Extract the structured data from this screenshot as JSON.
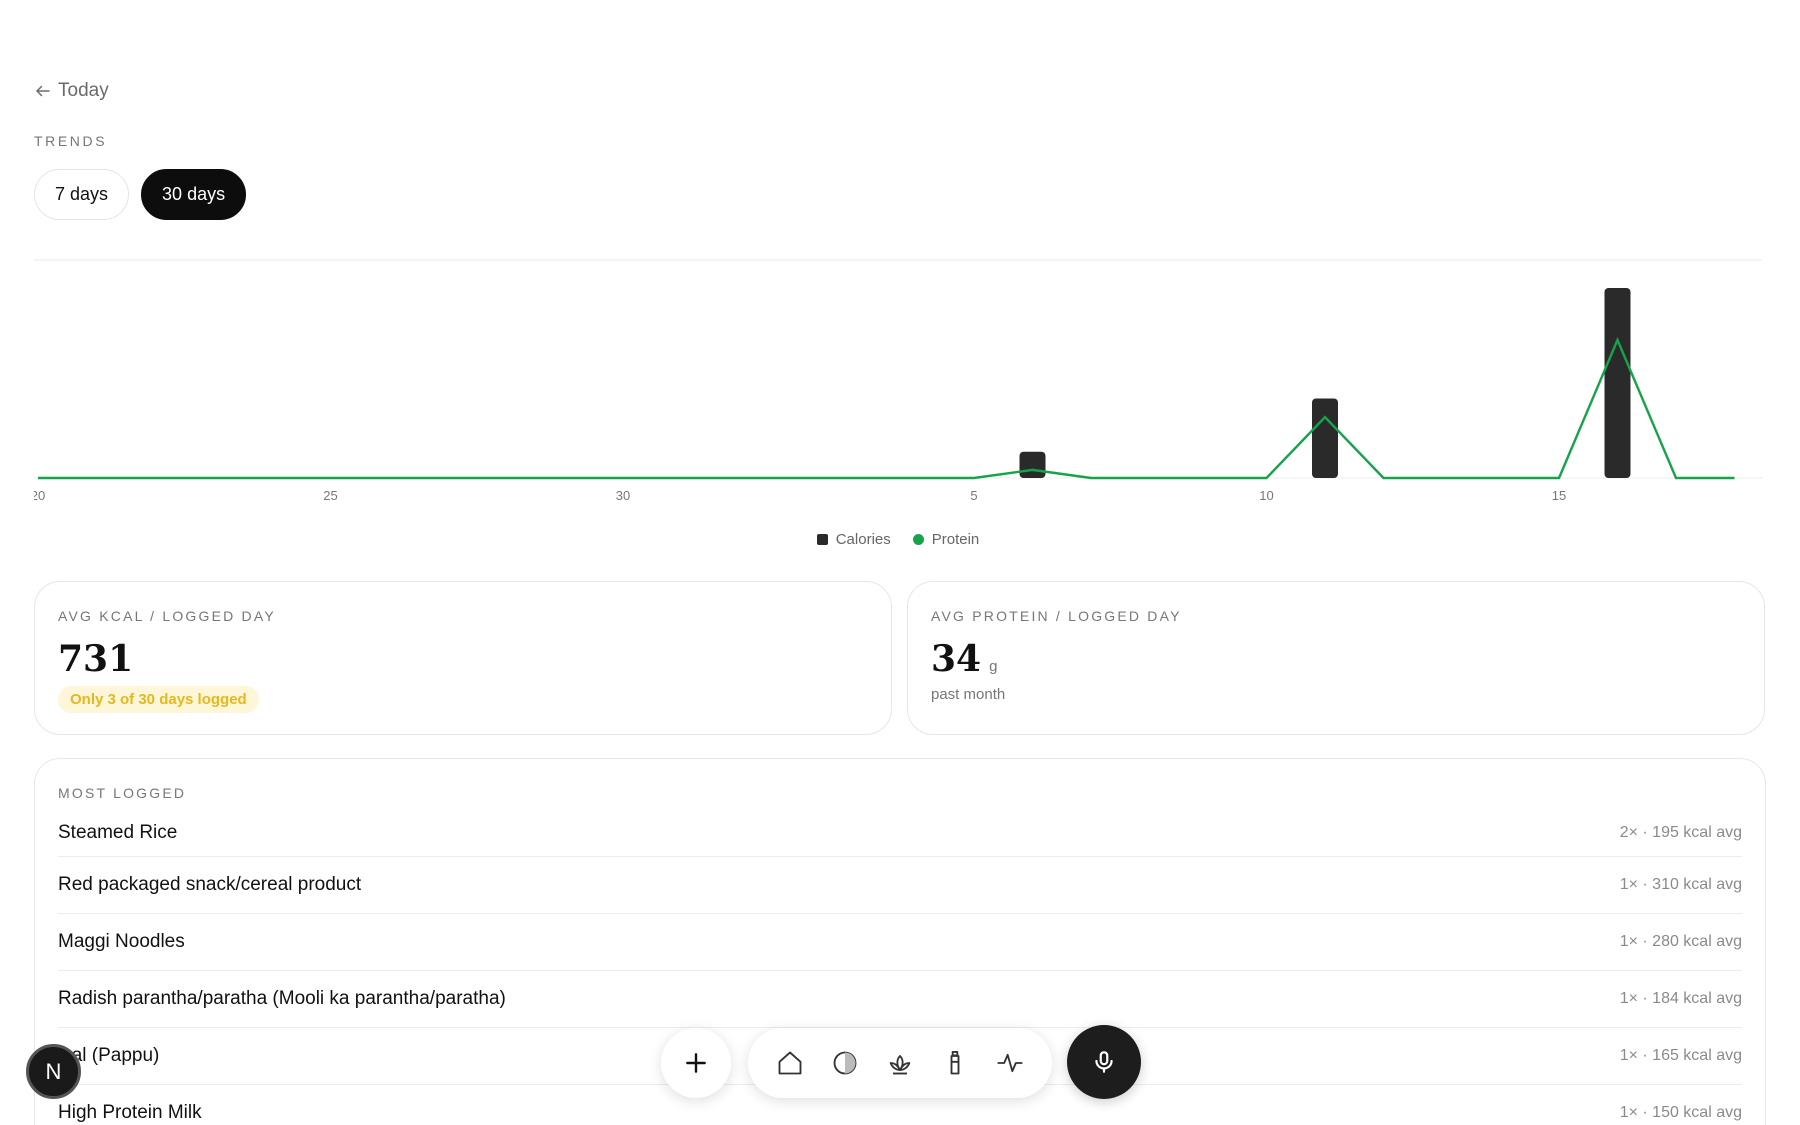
{
  "nav": {
    "back_label": "Today"
  },
  "trends": {
    "section_label": "TRENDS",
    "tabs": [
      {
        "label": "7 days",
        "active": false
      },
      {
        "label": "30 days",
        "active": true
      }
    ]
  },
  "chart_data": {
    "type": "bar",
    "x_tick_labels": [
      "20",
      "25",
      "30",
      "5",
      "10",
      "15"
    ],
    "days": [
      "20",
      "21",
      "22",
      "23",
      "24",
      "25",
      "26",
      "27",
      "28",
      "29",
      "30",
      "31",
      "1",
      "2",
      "3",
      "4",
      "5",
      "6",
      "7",
      "8",
      "9",
      "10",
      "11",
      "12",
      "13",
      "14",
      "15",
      "16",
      "17",
      "18"
    ],
    "series": [
      {
        "name": "Calories",
        "kind": "bar",
        "color": "#2a2a2a",
        "values": [
          0,
          0,
          0,
          0,
          0,
          0,
          0,
          0,
          0,
          0,
          0,
          0,
          0,
          0,
          0,
          0,
          0,
          195,
          0,
          0,
          0,
          0,
          590,
          0,
          0,
          0,
          0,
          1410,
          0,
          0
        ]
      },
      {
        "name": "Protein",
        "kind": "line",
        "color": "#16a34a",
        "values": [
          0,
          0,
          0,
          0,
          0,
          0,
          0,
          0,
          0,
          0,
          0,
          0,
          0,
          0,
          0,
          0,
          0,
          4,
          0,
          0,
          0,
          0,
          30,
          0,
          0,
          0,
          0,
          68,
          0,
          0
        ]
      }
    ],
    "legend": [
      "Calories",
      "Protein"
    ],
    "legend_position": "bottom-center",
    "grid": false
  },
  "stats": {
    "kcal": {
      "label": "AVG KCAL / LOGGED DAY",
      "value": "731",
      "badge": "Only 3 of 30 days logged"
    },
    "protein": {
      "label": "AVG PROTEIN / LOGGED DAY",
      "value": "34",
      "unit": "g",
      "sub": "past month"
    }
  },
  "most_logged": {
    "label": "MOST LOGGED",
    "items": [
      {
        "name": "Steamed Rice",
        "meta": "2× · 195 kcal avg"
      },
      {
        "name": "Red packaged snack/cereal product",
        "meta": "1× · 310 kcal avg"
      },
      {
        "name": "Maggi Noodles",
        "meta": "1× · 280 kcal avg"
      },
      {
        "name": "Radish parantha/paratha (Mooli ka parantha/paratha)",
        "meta": "1× · 184 kcal avg"
      },
      {
        "name": "Dal (Pappu)",
        "meta": "1× · 165 kcal avg"
      },
      {
        "name": "High Protein Milk",
        "meta": "1× · 150 kcal avg"
      }
    ]
  },
  "dock": {
    "icons": [
      "plus-icon",
      "home-icon",
      "circle-half-icon",
      "lotus-icon",
      "bottle-icon",
      "activity-icon",
      "microphone-icon"
    ]
  },
  "badge_letter": "N"
}
